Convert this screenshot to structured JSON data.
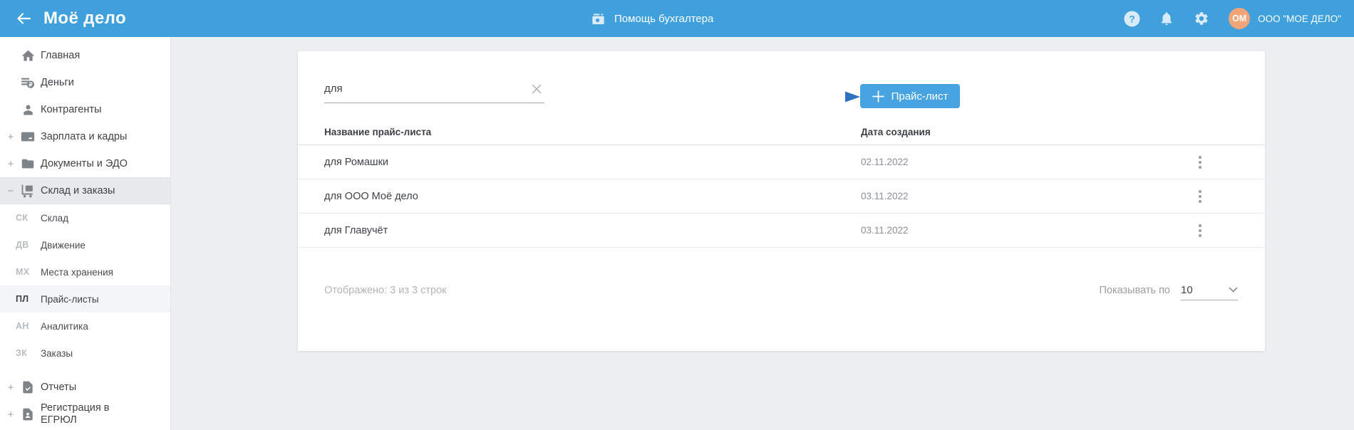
{
  "header": {
    "logo": "Моё дело",
    "help_label": "Помощь бухгалтера",
    "account": {
      "initials": "ОМ",
      "company": "ООО \"МОЕ ДЕЛО\""
    }
  },
  "sidebar": {
    "items": [
      {
        "label": "Главная",
        "icon": "home-icon"
      },
      {
        "label": "Деньги",
        "icon": "money-icon"
      },
      {
        "label": "Контрагенты",
        "icon": "contractors-icon"
      },
      {
        "label": "Зарплата и кадры",
        "icon": "salary-icon",
        "expand": "+"
      },
      {
        "label": "Документы и ЭДО",
        "icon": "documents-icon",
        "expand": "+"
      },
      {
        "label": "Склад и заказы",
        "icon": "warehouse-icon",
        "expand": "−",
        "active": true
      }
    ],
    "subitems": [
      {
        "code": "СК",
        "label": "Склад"
      },
      {
        "code": "ДВ",
        "label": "Движение"
      },
      {
        "code": "МХ",
        "label": "Места хранения"
      },
      {
        "code": "ПЛ",
        "label": "Прайс-листы",
        "active": true
      },
      {
        "code": "АН",
        "label": "Аналитика"
      },
      {
        "code": "ЗК",
        "label": "Заказы"
      }
    ],
    "bottom_items": [
      {
        "label": "Отчеты",
        "icon": "reports-icon",
        "expand": "+"
      },
      {
        "label": "Регистрация в ЕГРЮЛ",
        "icon": "registration-icon",
        "expand": "+"
      }
    ]
  },
  "main": {
    "search": {
      "value": "для"
    },
    "add_button": {
      "label": "Прайс-лист"
    },
    "table": {
      "columns": {
        "name": "Название прайс-листа",
        "date": "Дата создания"
      },
      "rows": [
        {
          "name": "для Ромашки",
          "date": "02.11.2022"
        },
        {
          "name": "для ООО Моё дело",
          "date": "03.11.2022"
        },
        {
          "name": "для Главучёт",
          "date": "03.11.2022"
        }
      ]
    },
    "footer": {
      "shown": "Отображено: 3 из 3 строк",
      "per_page_label": "Показывать по",
      "per_page_value": "10"
    }
  },
  "colors": {
    "header_bar": "#3FA0DC",
    "accent_button": "#47A4E0",
    "avatar_bg": "#F0A477",
    "annotation_arrow": "#3C7BCA",
    "page_bg": "#ECEFF1"
  }
}
